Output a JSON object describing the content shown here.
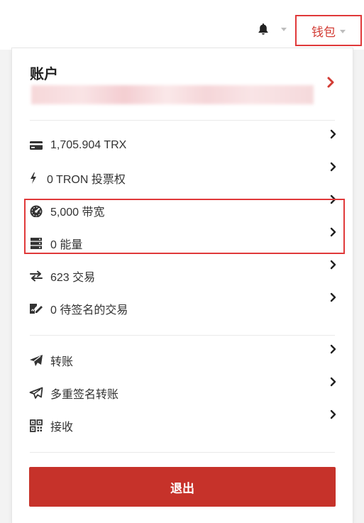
{
  "header": {
    "notification_icon": "bell-icon",
    "wallet_label": "钱包"
  },
  "account": {
    "title": "账户",
    "address": ""
  },
  "stats": [
    {
      "icon": "credit-card-icon",
      "label": "1,705.904 TRX"
    },
    {
      "icon": "lightning-icon",
      "label": "0 TRON 投票权"
    },
    {
      "icon": "speedometer-icon",
      "label": "5,000 带宽"
    },
    {
      "icon": "server-icon",
      "label": "0 能量"
    },
    {
      "icon": "exchange-arrows-icon",
      "label": "623 交易"
    },
    {
      "icon": "signature-icon",
      "label": "0 待签名的交易"
    }
  ],
  "actions": [
    {
      "icon": "send-icon",
      "label": "转账"
    },
    {
      "icon": "send-outline-icon",
      "label": "多重签名转账"
    },
    {
      "icon": "qrcode-icon",
      "label": "接收"
    }
  ],
  "logout_label": "退出",
  "colors": {
    "accent": "#c6322a",
    "highlight_border": "#e0393a",
    "text": "#333333"
  }
}
